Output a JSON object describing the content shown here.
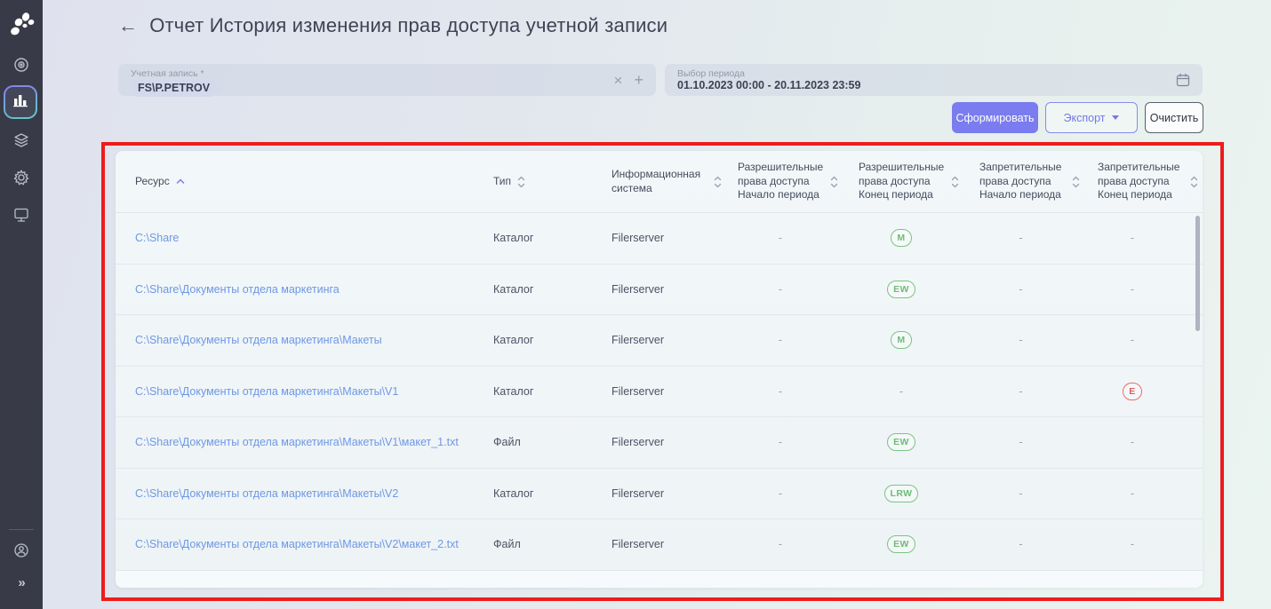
{
  "header": {
    "back_arrow": "←",
    "title": "Отчет История изменения прав доступа учетной записи"
  },
  "filters": {
    "account": {
      "label": "Учетная запись *",
      "value": "FS\\P.PETROV",
      "clear_icon": "×",
      "add_icon": "+"
    },
    "period": {
      "label": "Выбор периода",
      "value": "01.10.2023 00:00 - 20.11.2023 23:59",
      "calendar_icon": "calendar-icon"
    }
  },
  "actions": {
    "generate_label": "Сформировать",
    "export_label": "Экспорт",
    "clear_label": "Очистить"
  },
  "sidebar": {
    "logo_icon": "app-logo",
    "items": [
      {
        "icon": "eye-icon",
        "active": false
      },
      {
        "icon": "bar-chart-icon",
        "active": true
      },
      {
        "icon": "layers-icon",
        "active": false
      },
      {
        "icon": "gear-icon",
        "active": false
      },
      {
        "icon": "monitor-icon",
        "active": false
      }
    ],
    "footer": {
      "user_icon": "user-icon",
      "collapse_label": "»"
    }
  },
  "table": {
    "columns": [
      {
        "label": "Ресурс",
        "sort": "asc"
      },
      {
        "label": "Тип",
        "sort": "both"
      },
      {
        "label": "Информационная система",
        "sort": "both"
      },
      {
        "label": "Разрешительные права доступа Начало периода",
        "sort": "both"
      },
      {
        "label": "Разрешительные права доступа Конец периода",
        "sort": "both"
      },
      {
        "label": "Запретительные права доступа Начало периода",
        "sort": "both"
      },
      {
        "label": "Запретительные права доступа Конец периода",
        "sort": "both"
      }
    ],
    "rows": [
      {
        "resource": "C:\\Share",
        "type": "Каталог",
        "system": "Filerserver",
        "rights": [
          "-",
          {
            "badge": "M",
            "variant": "green"
          },
          "-",
          "-"
        ]
      },
      {
        "resource": "C:\\Share\\Документы отдела маркетинга",
        "type": "Каталог",
        "system": "Filerserver",
        "rights": [
          "-",
          {
            "badge": "EW",
            "variant": "green"
          },
          "-",
          "-"
        ]
      },
      {
        "resource": "C:\\Share\\Документы отдела маркетинга\\Макеты",
        "type": "Каталог",
        "system": "Filerserver",
        "rights": [
          "-",
          {
            "badge": "M",
            "variant": "green"
          },
          "-",
          "-"
        ]
      },
      {
        "resource": "C:\\Share\\Документы отдела маркетинга\\Макеты\\V1",
        "type": "Каталог",
        "system": "Filerserver",
        "rights": [
          "-",
          "-",
          "-",
          {
            "badge": "E",
            "variant": "red"
          }
        ]
      },
      {
        "resource": "C:\\Share\\Документы отдела маркетинга\\Макеты\\V1\\макет_1.txt",
        "type": "Файл",
        "system": "Filerserver",
        "rights": [
          "-",
          {
            "badge": "EW",
            "variant": "green"
          },
          "-",
          "-"
        ]
      },
      {
        "resource": "C:\\Share\\Документы отдела маркетинга\\Макеты\\V2",
        "type": "Каталог",
        "system": "Filerserver",
        "rights": [
          "-",
          {
            "badge": "LRW",
            "variant": "green"
          },
          "-",
          "-"
        ]
      },
      {
        "resource": "C:\\Share\\Документы отдела маркетинга\\Макеты\\V2\\макет_2.txt",
        "type": "Файл",
        "system": "Filerserver",
        "rights": [
          "-",
          {
            "badge": "EW",
            "variant": "green"
          },
          "-",
          "-"
        ]
      }
    ]
  },
  "colors": {
    "accent": "#7a7cef",
    "badge_green": "#6fbd74",
    "badge_red": "#e05d5d",
    "annotation_red": "#ee1c1c",
    "link_blue": "#6d98e4",
    "sidebar_bg": "#383b47"
  }
}
